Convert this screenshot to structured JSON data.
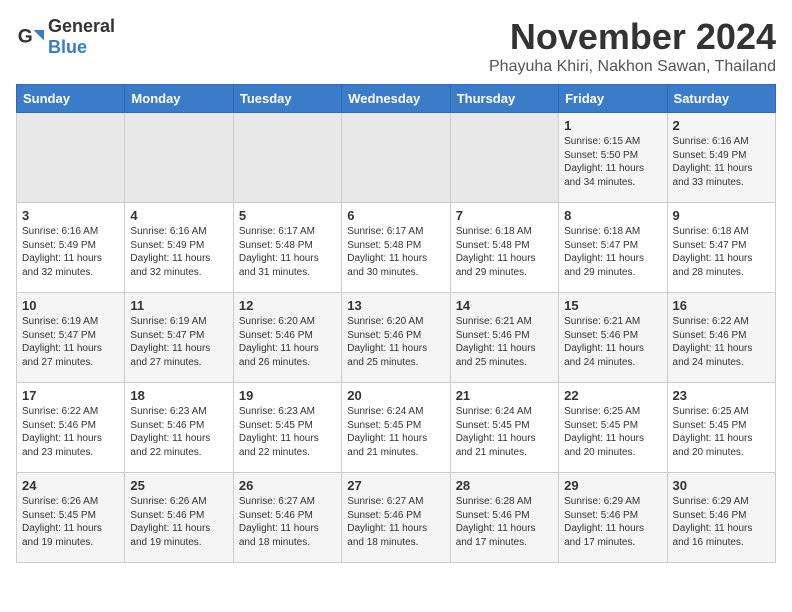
{
  "header": {
    "logo": {
      "general": "General",
      "blue": "Blue"
    },
    "title": "November 2024",
    "subtitle": "Phayuha Khiri, Nakhon Sawan, Thailand"
  },
  "weekdays": [
    "Sunday",
    "Monday",
    "Tuesday",
    "Wednesday",
    "Thursday",
    "Friday",
    "Saturday"
  ],
  "weeks": [
    [
      {
        "day": "",
        "info": ""
      },
      {
        "day": "",
        "info": ""
      },
      {
        "day": "",
        "info": ""
      },
      {
        "day": "",
        "info": ""
      },
      {
        "day": "",
        "info": ""
      },
      {
        "day": "1",
        "info": "Sunrise: 6:15 AM\nSunset: 5:50 PM\nDaylight: 11 hours and 34 minutes."
      },
      {
        "day": "2",
        "info": "Sunrise: 6:16 AM\nSunset: 5:49 PM\nDaylight: 11 hours and 33 minutes."
      }
    ],
    [
      {
        "day": "3",
        "info": "Sunrise: 6:16 AM\nSunset: 5:49 PM\nDaylight: 11 hours and 32 minutes."
      },
      {
        "day": "4",
        "info": "Sunrise: 6:16 AM\nSunset: 5:49 PM\nDaylight: 11 hours and 32 minutes."
      },
      {
        "day": "5",
        "info": "Sunrise: 6:17 AM\nSunset: 5:48 PM\nDaylight: 11 hours and 31 minutes."
      },
      {
        "day": "6",
        "info": "Sunrise: 6:17 AM\nSunset: 5:48 PM\nDaylight: 11 hours and 30 minutes."
      },
      {
        "day": "7",
        "info": "Sunrise: 6:18 AM\nSunset: 5:48 PM\nDaylight: 11 hours and 29 minutes."
      },
      {
        "day": "8",
        "info": "Sunrise: 6:18 AM\nSunset: 5:47 PM\nDaylight: 11 hours and 29 minutes."
      },
      {
        "day": "9",
        "info": "Sunrise: 6:18 AM\nSunset: 5:47 PM\nDaylight: 11 hours and 28 minutes."
      }
    ],
    [
      {
        "day": "10",
        "info": "Sunrise: 6:19 AM\nSunset: 5:47 PM\nDaylight: 11 hours and 27 minutes."
      },
      {
        "day": "11",
        "info": "Sunrise: 6:19 AM\nSunset: 5:47 PM\nDaylight: 11 hours and 27 minutes."
      },
      {
        "day": "12",
        "info": "Sunrise: 6:20 AM\nSunset: 5:46 PM\nDaylight: 11 hours and 26 minutes."
      },
      {
        "day": "13",
        "info": "Sunrise: 6:20 AM\nSunset: 5:46 PM\nDaylight: 11 hours and 25 minutes."
      },
      {
        "day": "14",
        "info": "Sunrise: 6:21 AM\nSunset: 5:46 PM\nDaylight: 11 hours and 25 minutes."
      },
      {
        "day": "15",
        "info": "Sunrise: 6:21 AM\nSunset: 5:46 PM\nDaylight: 11 hours and 24 minutes."
      },
      {
        "day": "16",
        "info": "Sunrise: 6:22 AM\nSunset: 5:46 PM\nDaylight: 11 hours and 24 minutes."
      }
    ],
    [
      {
        "day": "17",
        "info": "Sunrise: 6:22 AM\nSunset: 5:46 PM\nDaylight: 11 hours and 23 minutes."
      },
      {
        "day": "18",
        "info": "Sunrise: 6:23 AM\nSunset: 5:46 PM\nDaylight: 11 hours and 22 minutes."
      },
      {
        "day": "19",
        "info": "Sunrise: 6:23 AM\nSunset: 5:45 PM\nDaylight: 11 hours and 22 minutes."
      },
      {
        "day": "20",
        "info": "Sunrise: 6:24 AM\nSunset: 5:45 PM\nDaylight: 11 hours and 21 minutes."
      },
      {
        "day": "21",
        "info": "Sunrise: 6:24 AM\nSunset: 5:45 PM\nDaylight: 11 hours and 21 minutes."
      },
      {
        "day": "22",
        "info": "Sunrise: 6:25 AM\nSunset: 5:45 PM\nDaylight: 11 hours and 20 minutes."
      },
      {
        "day": "23",
        "info": "Sunrise: 6:25 AM\nSunset: 5:45 PM\nDaylight: 11 hours and 20 minutes."
      }
    ],
    [
      {
        "day": "24",
        "info": "Sunrise: 6:26 AM\nSunset: 5:45 PM\nDaylight: 11 hours and 19 minutes."
      },
      {
        "day": "25",
        "info": "Sunrise: 6:26 AM\nSunset: 5:46 PM\nDaylight: 11 hours and 19 minutes."
      },
      {
        "day": "26",
        "info": "Sunrise: 6:27 AM\nSunset: 5:46 PM\nDaylight: 11 hours and 18 minutes."
      },
      {
        "day": "27",
        "info": "Sunrise: 6:27 AM\nSunset: 5:46 PM\nDaylight: 11 hours and 18 minutes."
      },
      {
        "day": "28",
        "info": "Sunrise: 6:28 AM\nSunset: 5:46 PM\nDaylight: 11 hours and 17 minutes."
      },
      {
        "day": "29",
        "info": "Sunrise: 6:29 AM\nSunset: 5:46 PM\nDaylight: 11 hours and 17 minutes."
      },
      {
        "day": "30",
        "info": "Sunrise: 6:29 AM\nSunset: 5:46 PM\nDaylight: 11 hours and 16 minutes."
      }
    ]
  ]
}
